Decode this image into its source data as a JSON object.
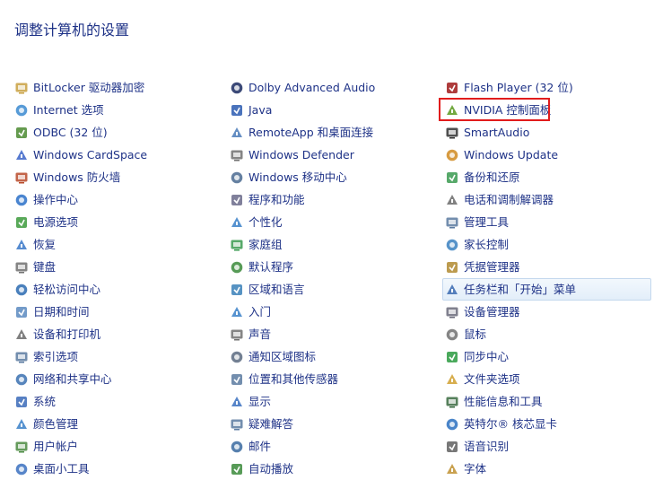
{
  "page": {
    "title": "调整计算机的设置"
  },
  "columns": [
    {
      "items": [
        {
          "label": "BitLocker 驱动器加密",
          "icon": "bitlocker-icon",
          "color": "#c8a040"
        },
        {
          "label": "Internet 选项",
          "icon": "internet-options-icon",
          "color": "#3a8ad0"
        },
        {
          "label": "ODBC (32 位)",
          "icon": "odbc-icon",
          "color": "#4a8a30"
        },
        {
          "label": "Windows CardSpace",
          "icon": "cardspace-icon",
          "color": "#3b64c8"
        },
        {
          "label": "Windows 防火墙",
          "icon": "firewall-icon",
          "color": "#b84a2a"
        },
        {
          "label": "操作中心",
          "icon": "action-center-flag-icon",
          "color": "#2a70c8"
        },
        {
          "label": "电源选项",
          "icon": "power-options-icon",
          "color": "#3c9a3c"
        },
        {
          "label": "恢复",
          "icon": "recovery-icon",
          "color": "#3a78c8"
        },
        {
          "label": "键盘",
          "icon": "keyboard-icon",
          "color": "#707070"
        },
        {
          "label": "轻松访问中心",
          "icon": "ease-of-access-icon",
          "color": "#2a6ab0"
        },
        {
          "label": "日期和时间",
          "icon": "date-time-icon",
          "color": "#5a8ac0"
        },
        {
          "label": "设备和打印机",
          "icon": "devices-printers-icon",
          "color": "#6a6a6a"
        },
        {
          "label": "索引选项",
          "icon": "indexing-options-icon",
          "color": "#5a7aa0"
        },
        {
          "label": "网络和共享中心",
          "icon": "network-sharing-icon",
          "color": "#3a70b0"
        },
        {
          "label": "系统",
          "icon": "system-icon",
          "color": "#3a6ab8"
        },
        {
          "label": "颜色管理",
          "icon": "color-management-icon",
          "color": "#3a80c8"
        },
        {
          "label": "用户帐户",
          "icon": "user-accounts-icon",
          "color": "#4a8a40"
        },
        {
          "label": "桌面小工具",
          "icon": "desktop-gadgets-icon",
          "color": "#3a70c0"
        }
      ]
    },
    {
      "items": [
        {
          "label": "Dolby Advanced Audio",
          "icon": "dolby-icon",
          "color": "#1a2a60"
        },
        {
          "label": "Java",
          "icon": "java-icon",
          "color": "#2a5ab0"
        },
        {
          "label": "RemoteApp 和桌面连接",
          "icon": "remoteapp-icon",
          "color": "#4a7ab8"
        },
        {
          "label": "Windows Defender",
          "icon": "defender-icon",
          "color": "#707070"
        },
        {
          "label": "Windows 移动中心",
          "icon": "mobility-center-icon",
          "color": "#4a6a90"
        },
        {
          "label": "程序和功能",
          "icon": "programs-features-icon",
          "color": "#6a6a8a"
        },
        {
          "label": "个性化",
          "icon": "personalization-icon",
          "color": "#3a80c8"
        },
        {
          "label": "家庭组",
          "icon": "homegroup-icon",
          "color": "#3a9a50"
        },
        {
          "label": "默认程序",
          "icon": "default-programs-icon",
          "color": "#3a8a3a"
        },
        {
          "label": "区域和语言",
          "icon": "region-language-icon",
          "color": "#3a80b8"
        },
        {
          "label": "入门",
          "icon": "getting-started-icon",
          "color": "#3a80c8"
        },
        {
          "label": "声音",
          "icon": "sound-icon",
          "color": "#707070"
        },
        {
          "label": "通知区域图标",
          "icon": "notification-icons-icon",
          "color": "#5a6a80"
        },
        {
          "label": "位置和其他传感器",
          "icon": "location-sensors-icon",
          "color": "#5a7aa0"
        },
        {
          "label": "显示",
          "icon": "display-icon",
          "color": "#3a70c0"
        },
        {
          "label": "疑难解答",
          "icon": "troubleshooting-icon",
          "color": "#5a7aa0"
        },
        {
          "label": "邮件",
          "icon": "mail-icon",
          "color": "#3a6aa0"
        },
        {
          "label": "自动播放",
          "icon": "autoplay-icon",
          "color": "#3a8a3a"
        }
      ]
    },
    {
      "items": [
        {
          "label": "Flash Player (32 位)",
          "icon": "flash-player-icon",
          "color": "#a01a1a"
        },
        {
          "label": "NVIDIA 控制面板",
          "icon": "nvidia-icon",
          "color": "#5a9a20"
        },
        {
          "label": "SmartAudio",
          "icon": "smartaudio-icon",
          "color": "#303030"
        },
        {
          "label": "Windows Update",
          "icon": "windows-update-icon",
          "color": "#d08a20"
        },
        {
          "label": "备份和还原",
          "icon": "backup-restore-icon",
          "color": "#3a9a50"
        },
        {
          "label": "电话和调制解调器",
          "icon": "phone-modem-icon",
          "color": "#6a6a6a"
        },
        {
          "label": "管理工具",
          "icon": "admin-tools-icon",
          "color": "#5a7aa0"
        },
        {
          "label": "家长控制",
          "icon": "parental-controls-icon",
          "color": "#3a80c0"
        },
        {
          "label": "凭据管理器",
          "icon": "credential-manager-icon",
          "color": "#b08a30"
        },
        {
          "label": "任务栏和「开始」菜单",
          "icon": "taskbar-start-icon",
          "color": "#3a6ab0"
        },
        {
          "label": "设备管理器",
          "icon": "device-manager-icon",
          "color": "#6a6a7a"
        },
        {
          "label": "鼠标",
          "icon": "mouse-icon",
          "color": "#707070"
        },
        {
          "label": "同步中心",
          "icon": "sync-center-icon",
          "color": "#2a9a40"
        },
        {
          "label": "文件夹选项",
          "icon": "folder-options-icon",
          "color": "#d0a030"
        },
        {
          "label": "性能信息和工具",
          "icon": "performance-icon",
          "color": "#3a6a40"
        },
        {
          "label": "英特尔® 核芯显卡",
          "icon": "intel-graphics-icon",
          "color": "#2a70c0"
        },
        {
          "label": "语音识别",
          "icon": "speech-recognition-icon",
          "color": "#606060"
        },
        {
          "label": "字体",
          "icon": "fonts-icon",
          "color": "#c09030"
        }
      ]
    }
  ],
  "theme": {
    "link_color": "#1e3287",
    "highlight_box_color": "#e11c1c",
    "hover_row_bg": "#e3eef9"
  }
}
